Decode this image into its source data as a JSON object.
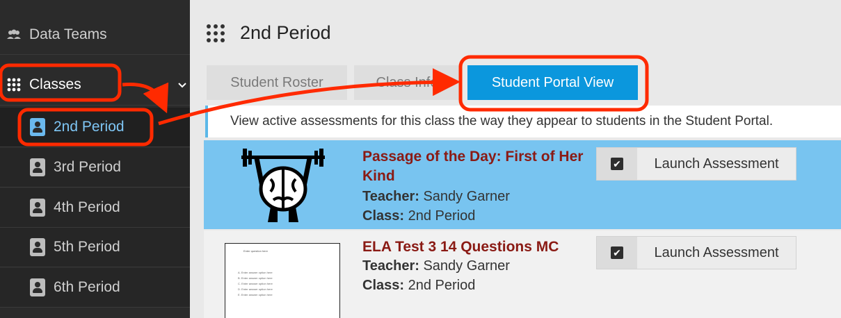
{
  "sidebar": {
    "data_teams": "Data Teams",
    "classes": "Classes",
    "periods": [
      {
        "label": "2nd Period",
        "active": true
      },
      {
        "label": "3rd Period",
        "active": false
      },
      {
        "label": "4th Period",
        "active": false
      },
      {
        "label": "5th Period",
        "active": false
      },
      {
        "label": "6th Period",
        "active": false
      }
    ]
  },
  "header": {
    "title": "2nd Period"
  },
  "tabs": [
    {
      "label": "Student Roster"
    },
    {
      "label": "Class Info"
    },
    {
      "label": "Student Portal View"
    }
  ],
  "info": "View active assessments for this class the way they appear to students in the Student Portal.",
  "assessments": [
    {
      "title": "Passage of the Day: First of Her Kind",
      "teacher_label": "Teacher:",
      "teacher": "Sandy Garner",
      "class_label": "Class:",
      "class": "2nd Period",
      "launch": "Launch Assessment"
    },
    {
      "title": "ELA Test 3 14 Questions MC",
      "teacher_label": "Teacher:",
      "teacher": "Sandy Garner",
      "class_label": "Class:",
      "class": "2nd Period",
      "launch": "Launch Assessment"
    }
  ],
  "thumbnail_text": {
    "question": "Enter question here",
    "options": [
      "A. Enter answer option here",
      "B. Enter answer option here",
      "C. Enter answer option here",
      "D. Enter answer option here",
      "E. Enter answer option here"
    ]
  },
  "colors": {
    "sidebar_bg": "#2b2b2b",
    "active_link": "#7fc6f5",
    "tab_active": "#0b97dd",
    "highlight_row": "#78c4f0",
    "assessment_title": "#8a1a14",
    "annotation": "#ff2a00"
  }
}
